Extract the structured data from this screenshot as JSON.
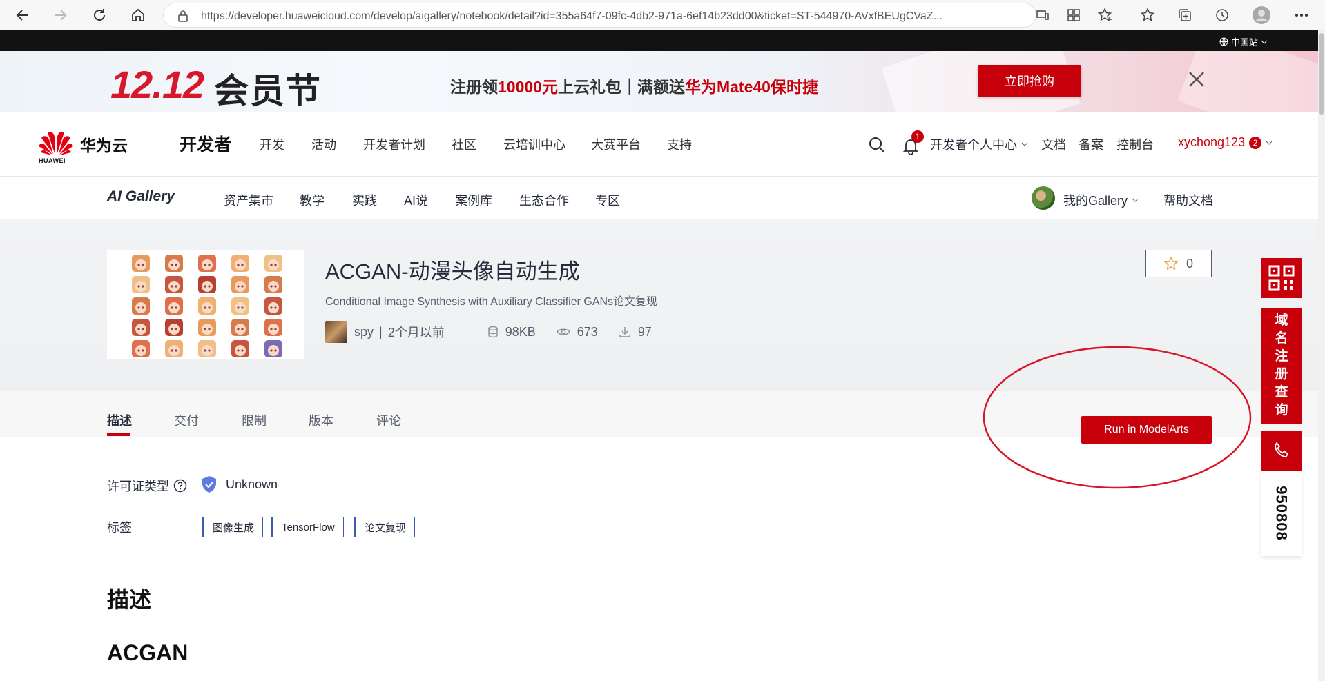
{
  "browser": {
    "url": "https://developer.huaweicloud.com/develop/aigallery/notebook/detail?id=355a64f7-09fc-4db2-971a-6ef14b23dd00&ticket=ST-544970-AVxfBEUgCVaZ..."
  },
  "topbar": {
    "region": "中国站"
  },
  "banner": {
    "title_num": "12.12",
    "title_text": "会员节",
    "promo_part1": "注册领",
    "promo_amount": "10000元",
    "promo_part2": "上云礼包｜满额送",
    "promo_prize": "华为Mate40保时捷",
    "cta": "立即抢购"
  },
  "header": {
    "logo_text": "华为云",
    "logo_small": "HUAWEI",
    "section": "开发者",
    "nav": [
      "开发",
      "活动",
      "开发者计划",
      "社区",
      "云培训中心",
      "大赛平台",
      "支持"
    ],
    "notification_count": "1",
    "personal_center": "开发者个人中心",
    "docs": "文档",
    "filing": "备案",
    "console": "控制台",
    "username": "xychong123",
    "user_badge": "2"
  },
  "gallery_nav": {
    "logo": "AI Gallery",
    "items": [
      "资产集市",
      "教学",
      "实践",
      "AI说",
      "案例库",
      "生态合作",
      "专区"
    ],
    "my_gallery": "我的Gallery",
    "help": "帮助文档"
  },
  "asset": {
    "title": "ACGAN-动漫头像自动生成",
    "subtitle": "Conditional Image Synthesis with Auxiliary Classifier GANs论文复现",
    "author": "spy",
    "time": "2个月以前",
    "size": "98KB",
    "views": "673",
    "downloads": "97",
    "stars": "0"
  },
  "tabs": [
    "描述",
    "交付",
    "限制",
    "版本",
    "评论"
  ],
  "run_button": "Run in ModelArts",
  "details": {
    "license_label": "许可证类型",
    "license_value": "Unknown",
    "tags_label": "标签",
    "tags": [
      "图像生成",
      "TensorFlow",
      "论文复现"
    ]
  },
  "content": {
    "heading1": "描述",
    "heading2": "ACGAN"
  },
  "float_panel": {
    "domain_text": [
      "域",
      "名",
      "注",
      "册",
      "查",
      "询"
    ],
    "phone_number": "950808"
  },
  "colors": {
    "brand_red": "#c7000b",
    "annotation_red": "#d9152a",
    "tag_border": "#3c5ab4"
  }
}
